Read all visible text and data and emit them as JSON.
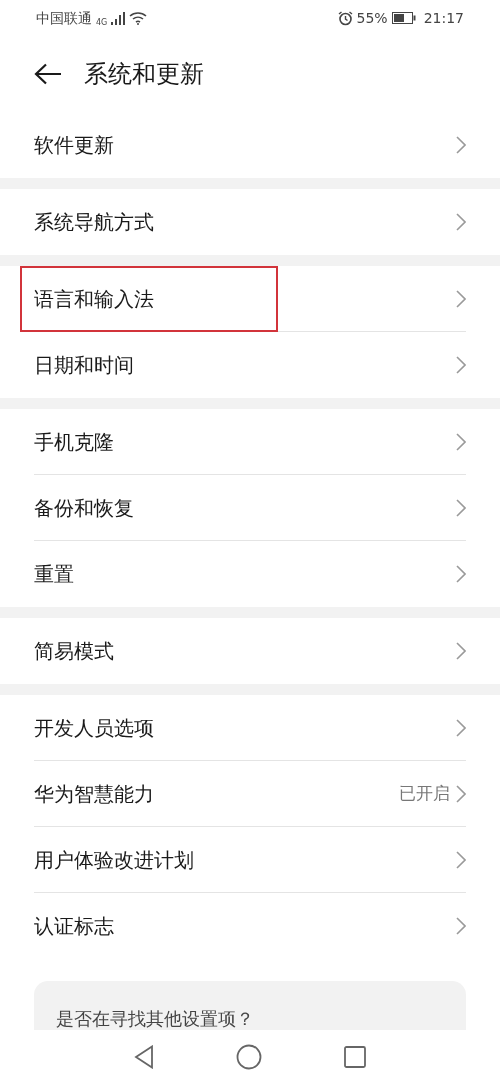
{
  "status_bar": {
    "carrier": "中国联通",
    "network": "4G",
    "battery": "55%",
    "time": "21:17"
  },
  "header": {
    "title": "系统和更新"
  },
  "groups": [
    {
      "items": [
        {
          "label": "软件更新",
          "highlighted": false
        }
      ]
    },
    {
      "items": [
        {
          "label": "系统导航方式",
          "highlighted": false
        }
      ]
    },
    {
      "items": [
        {
          "label": "语言和输入法",
          "highlighted": true
        },
        {
          "label": "日期和时间",
          "highlighted": false
        }
      ]
    },
    {
      "items": [
        {
          "label": "手机克隆",
          "highlighted": false
        },
        {
          "label": "备份和恢复",
          "highlighted": false
        },
        {
          "label": "重置",
          "highlighted": false
        }
      ]
    },
    {
      "items": [
        {
          "label": "简易模式",
          "highlighted": false
        }
      ]
    },
    {
      "items": [
        {
          "label": "开发人员选项",
          "highlighted": false
        },
        {
          "label": "华为智慧能力",
          "value": "已开启",
          "highlighted": false
        },
        {
          "label": "用户体验改进计划",
          "highlighted": false
        },
        {
          "label": "认证标志",
          "highlighted": false
        }
      ]
    }
  ],
  "suggestion": {
    "title": "是否在寻找其他设置项？"
  }
}
